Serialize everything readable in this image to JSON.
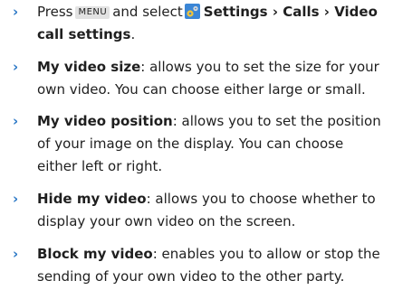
{
  "bullet_glyph": "›",
  "step": {
    "press": "Press",
    "menu_key": "MENU",
    "and_select": "and select",
    "settings_icon": "settings-gear-icon",
    "path": "Settings › Calls › Video call settings",
    "end": "."
  },
  "items": [
    {
      "term": "My video size",
      "desc": ": allows you to set the size for your own video. You can choose either large or small."
    },
    {
      "term": "My video position",
      "desc": ": allows you to set the position of your image on the display. You can choose either left or right."
    },
    {
      "term": "Hide my video",
      "desc": ": allows you to choose whether to display your own video on the screen."
    },
    {
      "term": "Block my video",
      "desc": ": enables you to allow or stop the sending of your own video to the other party."
    }
  ],
  "colors": {
    "bullet": "#2b78c6",
    "text": "#1f1f1f",
    "key_bg": "#e2e2e2"
  }
}
